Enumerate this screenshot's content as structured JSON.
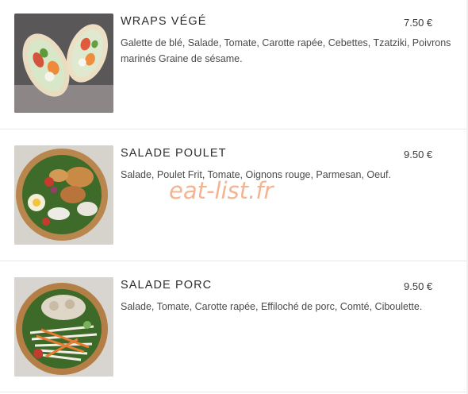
{
  "menu": {
    "items": [
      {
        "name": "WRAPS VÉGÉ",
        "price": "7.50 €",
        "description": "Galette de blé, Salade, Tomate, Carotte rapée, Cebettes, Tzatziki, Poivrons marinés Graine de sésame.",
        "image": "wrap-photo"
      },
      {
        "name": "SALADE POULET",
        "price": "9.50 €",
        "description": "Salade, Poulet Frit, Tomate, Oignons rouge, Parmesan, Oeuf.",
        "image": "chicken-salad-photo"
      },
      {
        "name": "SALADE PORC",
        "price": "9.50 €",
        "description": "Salade, Tomate, Carotte rapée, Effiloché de porc, Comté, Ciboulette.",
        "image": "pork-salad-photo"
      }
    ]
  },
  "watermark": "eat-list.fr",
  "colors": {
    "watermark": "#f3a77e",
    "text": "#2d2d2d",
    "divider": "#e8e8e8"
  }
}
